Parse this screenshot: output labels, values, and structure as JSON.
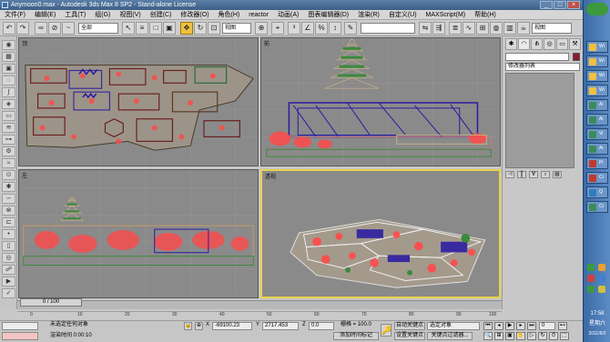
{
  "window": {
    "title": "Anymoon0.max - Autodesk 3ds Max 8 SP2  - Stand-alone License",
    "min": "_",
    "max": "□",
    "close": "×"
  },
  "menu": [
    "文件(F)",
    "编辑(E)",
    "工具(T)",
    "组(G)",
    "视图(V)",
    "创建(C)",
    "修改器(O)",
    "角色(H)",
    "reactor",
    "动画(A)",
    "图表编辑器(D)",
    "渲染(R)",
    "自定义(U)",
    "MAXScript(M)",
    "帮助(H)"
  ],
  "toolbar": {
    "selection_filter": "全部",
    "ref_coord": "视图",
    "named_set": ""
  },
  "viewports": [
    {
      "label": "顶",
      "active": false
    },
    {
      "label": "前",
      "active": false
    },
    {
      "label": "左",
      "active": false
    },
    {
      "label": "透视",
      "active": true
    }
  ],
  "command_panel": {
    "object_name": "",
    "modifier_list": "修改器列表",
    "color": "#8b1a2e"
  },
  "timeline": {
    "frame_text": "0 / 100"
  },
  "ruler": {
    "ticks": [
      "0",
      "10",
      "20",
      "30",
      "40",
      "50",
      "60",
      "70",
      "80",
      "90",
      "100"
    ]
  },
  "status": {
    "selection": "未选定任何对象",
    "render_time": "渲染时间  0:00:10",
    "x_label": "X",
    "x_value": "-69100.23",
    "y_label": "Y",
    "y_value": "2717.453",
    "z_label": "Z",
    "z_value": "0.0",
    "grid": "栅格 = 100.0",
    "add_time_tag": "添加时间标记",
    "auto_key": "自动关键点",
    "set_key": "设置关键点",
    "selected_objects": "选定对象",
    "key_filters": "关键点过滤器..."
  },
  "playback": {
    "frame": "0"
  },
  "taskbar": {
    "items": [
      {
        "label": "Wi",
        "color": "#f0c040"
      },
      {
        "label": "Wi",
        "color": "#f0c040"
      },
      {
        "label": "Wi",
        "color": "#f0c040"
      },
      {
        "label": "Wi",
        "color": "#f0c040"
      },
      {
        "label": "Ai",
        "color": "#3a8c5a"
      },
      {
        "label": "Ai",
        "color": "#3a8c5a"
      },
      {
        "label": "Vi",
        "color": "#3a8c5a"
      },
      {
        "label": "Ai",
        "color": "#3a8c5a"
      },
      {
        "label": "Pi",
        "color": "#c0392b"
      },
      {
        "label": "Ci",
        "color": "#c0392b"
      },
      {
        "label": "Q",
        "color": "#2f7dc0"
      },
      {
        "label": "Ci",
        "color": "#3a8c5a"
      }
    ],
    "time": "17:58",
    "weekday": "星期六",
    "date": "2011/6/2"
  }
}
